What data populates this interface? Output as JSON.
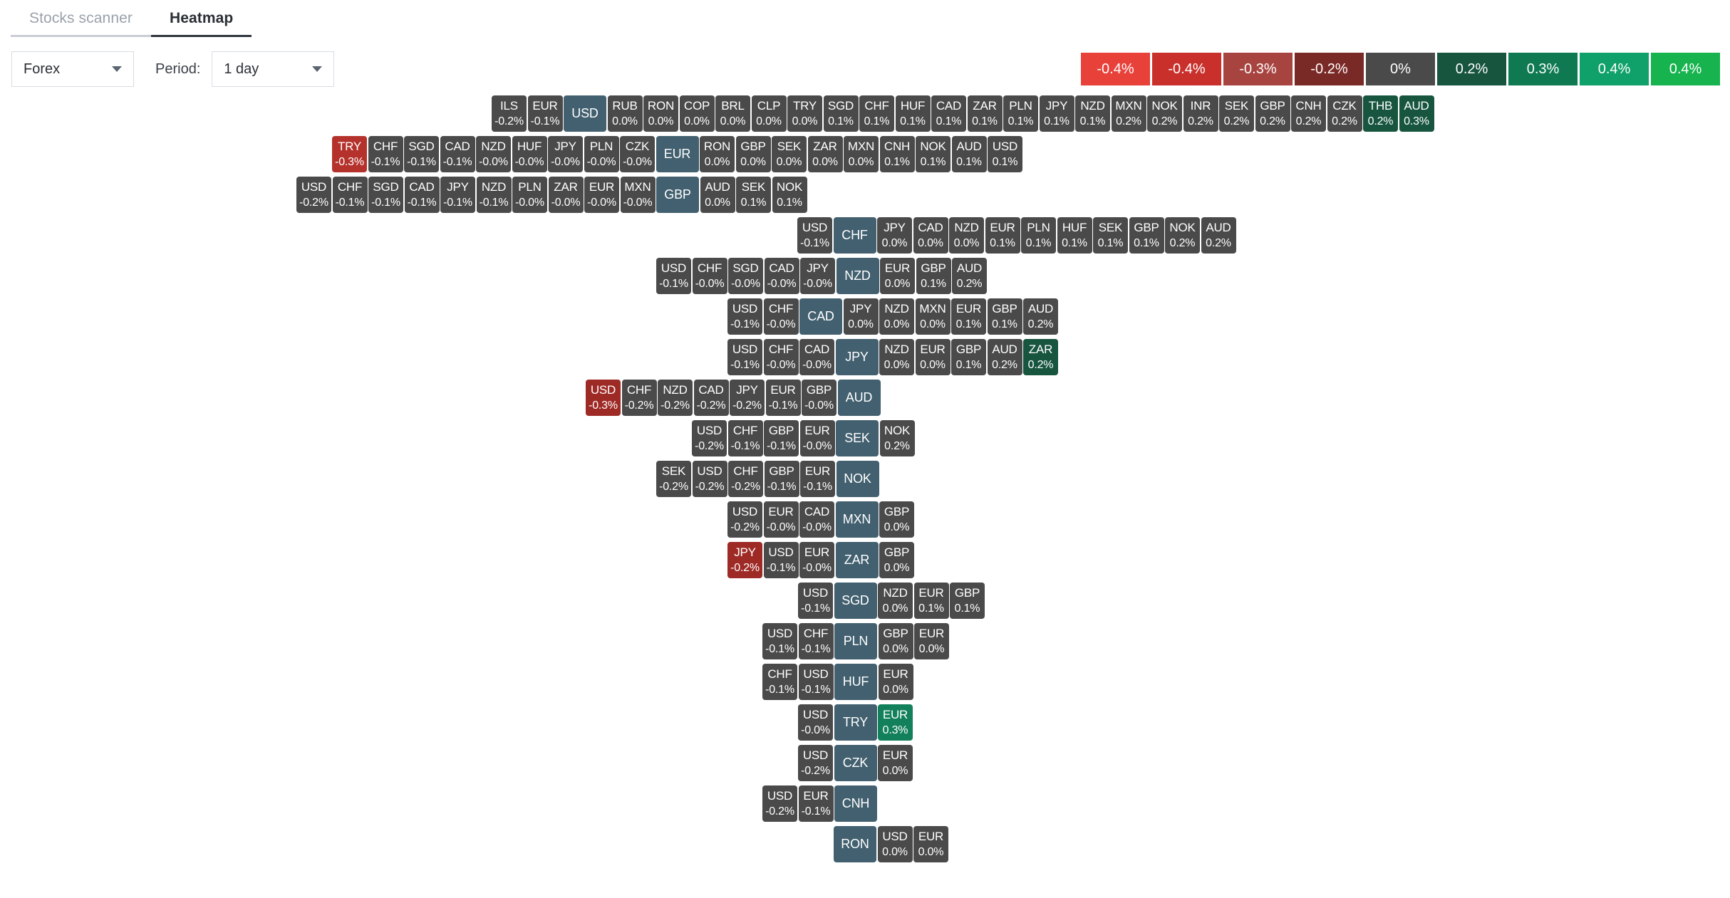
{
  "tabs": [
    {
      "label": "Stocks scanner",
      "active": false
    },
    {
      "label": "Heatmap",
      "active": true
    }
  ],
  "controls": {
    "market": "Forex",
    "period_label": "Period:",
    "period": "1 day",
    "market_caret_icon": "chevron-down-icon",
    "period_caret_icon": "chevron-down-icon"
  },
  "legend": [
    {
      "label": "-0.4%",
      "color": "#e8413a"
    },
    {
      "label": "-0.4%",
      "color": "#c9302c"
    },
    {
      "label": "-0.3%",
      "color": "#a84440"
    },
    {
      "label": "-0.2%",
      "color": "#7a2a26"
    },
    {
      "label": "0%",
      "color": "#4a4a4a"
    },
    {
      "label": "0.2%",
      "color": "#17553f"
    },
    {
      "label": "0.3%",
      "color": "#0f7a52"
    },
    {
      "label": "0.4%",
      "color": "#10a16a"
    },
    {
      "label": "0.4%",
      "color": "#16b34e"
    }
  ],
  "colors": {
    "neutral": "#4a4a4a",
    "base": "#42606f",
    "red_strong": "#9e2a26",
    "red_mid": "#b5322c",
    "green_dark": "#17553f",
    "green_mid": "#12805a"
  },
  "chart_data": {
    "type": "heatmap",
    "title": "Forex Heatmap",
    "period": "1 day",
    "value_unit": "percent",
    "rows": [
      {
        "base": "USD",
        "offset": 690,
        "cells": [
          {
            "sym": "ILS",
            "val": "-0.2%",
            "color": "#4a4a4a"
          },
          {
            "sym": "EUR",
            "val": "-0.1%",
            "color": "#4a4a4a"
          },
          {
            "sym": "USD",
            "val": "",
            "base": true
          },
          {
            "sym": "RUB",
            "val": "0.0%",
            "color": "#4a4a4a"
          },
          {
            "sym": "RON",
            "val": "0.0%",
            "color": "#4a4a4a"
          },
          {
            "sym": "COP",
            "val": "0.0%",
            "color": "#4a4a4a"
          },
          {
            "sym": "BRL",
            "val": "0.0%",
            "color": "#4a4a4a"
          },
          {
            "sym": "CLP",
            "val": "0.0%",
            "color": "#4a4a4a"
          },
          {
            "sym": "TRY",
            "val": "0.0%",
            "color": "#4a4a4a"
          },
          {
            "sym": "SGD",
            "val": "0.1%",
            "color": "#4a4a4a"
          },
          {
            "sym": "CHF",
            "val": "0.1%",
            "color": "#4a4a4a"
          },
          {
            "sym": "HUF",
            "val": "0.1%",
            "color": "#4a4a4a"
          },
          {
            "sym": "CAD",
            "val": "0.1%",
            "color": "#4a4a4a"
          },
          {
            "sym": "ZAR",
            "val": "0.1%",
            "color": "#4a4a4a"
          },
          {
            "sym": "PLN",
            "val": "0.1%",
            "color": "#4a4a4a"
          },
          {
            "sym": "JPY",
            "val": "0.1%",
            "color": "#4a4a4a"
          },
          {
            "sym": "NZD",
            "val": "0.1%",
            "color": "#4a4a4a"
          },
          {
            "sym": "MXN",
            "val": "0.2%",
            "color": "#4a4a4a"
          },
          {
            "sym": "NOK",
            "val": "0.2%",
            "color": "#4a4a4a"
          },
          {
            "sym": "INR",
            "val": "0.2%",
            "color": "#4a4a4a"
          },
          {
            "sym": "SEK",
            "val": "0.2%",
            "color": "#4a4a4a"
          },
          {
            "sym": "GBP",
            "val": "0.2%",
            "color": "#4a4a4a"
          },
          {
            "sym": "CNH",
            "val": "0.2%",
            "color": "#4a4a4a"
          },
          {
            "sym": "CZK",
            "val": "0.2%",
            "color": "#4a4a4a"
          },
          {
            "sym": "THB",
            "val": "0.2%",
            "color": "#17553f"
          },
          {
            "sym": "AUD",
            "val": "0.3%",
            "color": "#17553f"
          }
        ]
      },
      {
        "base": "EUR",
        "offset": 466,
        "cells": [
          {
            "sym": "TRY",
            "val": "-0.3%",
            "color": "#b5322c"
          },
          {
            "sym": "CHF",
            "val": "-0.1%",
            "color": "#4a4a4a"
          },
          {
            "sym": "SGD",
            "val": "-0.1%",
            "color": "#4a4a4a"
          },
          {
            "sym": "CAD",
            "val": "-0.1%",
            "color": "#4a4a4a"
          },
          {
            "sym": "NZD",
            "val": "-0.0%",
            "color": "#4a4a4a"
          },
          {
            "sym": "HUF",
            "val": "-0.0%",
            "color": "#4a4a4a"
          },
          {
            "sym": "JPY",
            "val": "-0.0%",
            "color": "#4a4a4a"
          },
          {
            "sym": "PLN",
            "val": "-0.0%",
            "color": "#4a4a4a"
          },
          {
            "sym": "CZK",
            "val": "-0.0%",
            "color": "#4a4a4a"
          },
          {
            "sym": "EUR",
            "val": "",
            "base": true
          },
          {
            "sym": "RON",
            "val": "0.0%",
            "color": "#4a4a4a"
          },
          {
            "sym": "GBP",
            "val": "0.0%",
            "color": "#4a4a4a"
          },
          {
            "sym": "SEK",
            "val": "0.0%",
            "color": "#4a4a4a"
          },
          {
            "sym": "ZAR",
            "val": "0.0%",
            "color": "#4a4a4a"
          },
          {
            "sym": "MXN",
            "val": "0.0%",
            "color": "#4a4a4a"
          },
          {
            "sym": "CNH",
            "val": "0.1%",
            "color": "#4a4a4a"
          },
          {
            "sym": "NOK",
            "val": "0.1%",
            "color": "#4a4a4a"
          },
          {
            "sym": "AUD",
            "val": "0.1%",
            "color": "#4a4a4a"
          },
          {
            "sym": "USD",
            "val": "0.1%",
            "color": "#4a4a4a"
          }
        ]
      },
      {
        "base": "GBP",
        "offset": 416,
        "cells": [
          {
            "sym": "USD",
            "val": "-0.2%",
            "color": "#4a4a4a"
          },
          {
            "sym": "CHF",
            "val": "-0.1%",
            "color": "#4a4a4a"
          },
          {
            "sym": "SGD",
            "val": "-0.1%",
            "color": "#4a4a4a"
          },
          {
            "sym": "CAD",
            "val": "-0.1%",
            "color": "#4a4a4a"
          },
          {
            "sym": "JPY",
            "val": "-0.1%",
            "color": "#4a4a4a"
          },
          {
            "sym": "NZD",
            "val": "-0.1%",
            "color": "#4a4a4a"
          },
          {
            "sym": "PLN",
            "val": "-0.0%",
            "color": "#4a4a4a"
          },
          {
            "sym": "ZAR",
            "val": "-0.0%",
            "color": "#4a4a4a"
          },
          {
            "sym": "EUR",
            "val": "-0.0%",
            "color": "#4a4a4a"
          },
          {
            "sym": "MXN",
            "val": "-0.0%",
            "color": "#4a4a4a"
          },
          {
            "sym": "GBP",
            "val": "",
            "base": true
          },
          {
            "sym": "AUD",
            "val": "0.0%",
            "color": "#4a4a4a"
          },
          {
            "sym": "SEK",
            "val": "0.1%",
            "color": "#4a4a4a"
          },
          {
            "sym": "NOK",
            "val": "0.1%",
            "color": "#4a4a4a"
          }
        ]
      },
      {
        "base": "CHF",
        "offset": 1119,
        "cells": [
          {
            "sym": "USD",
            "val": "-0.1%",
            "color": "#4a4a4a"
          },
          {
            "sym": "CHF",
            "val": "",
            "base": true
          },
          {
            "sym": "JPY",
            "val": "0.0%",
            "color": "#4a4a4a"
          },
          {
            "sym": "CAD",
            "val": "0.0%",
            "color": "#4a4a4a"
          },
          {
            "sym": "NZD",
            "val": "0.0%",
            "color": "#4a4a4a"
          },
          {
            "sym": "EUR",
            "val": "0.1%",
            "color": "#4a4a4a"
          },
          {
            "sym": "PLN",
            "val": "0.1%",
            "color": "#4a4a4a"
          },
          {
            "sym": "HUF",
            "val": "0.1%",
            "color": "#4a4a4a"
          },
          {
            "sym": "SEK",
            "val": "0.1%",
            "color": "#4a4a4a"
          },
          {
            "sym": "GBP",
            "val": "0.1%",
            "color": "#4a4a4a"
          },
          {
            "sym": "NOK",
            "val": "0.2%",
            "color": "#4a4a4a"
          },
          {
            "sym": "AUD",
            "val": "0.2%",
            "color": "#4a4a4a"
          }
        ]
      },
      {
        "base": "NZD",
        "offset": 921,
        "cells": [
          {
            "sym": "USD",
            "val": "-0.1%",
            "color": "#4a4a4a"
          },
          {
            "sym": "CHF",
            "val": "-0.0%",
            "color": "#4a4a4a"
          },
          {
            "sym": "SGD",
            "val": "-0.0%",
            "color": "#4a4a4a"
          },
          {
            "sym": "CAD",
            "val": "-0.0%",
            "color": "#4a4a4a"
          },
          {
            "sym": "JPY",
            "val": "-0.0%",
            "color": "#4a4a4a"
          },
          {
            "sym": "NZD",
            "val": "",
            "base": true
          },
          {
            "sym": "EUR",
            "val": "0.0%",
            "color": "#4a4a4a"
          },
          {
            "sym": "GBP",
            "val": "0.1%",
            "color": "#4a4a4a"
          },
          {
            "sym": "AUD",
            "val": "0.2%",
            "color": "#4a4a4a"
          }
        ]
      },
      {
        "base": "CAD",
        "offset": 1021,
        "cells": [
          {
            "sym": "USD",
            "val": "-0.1%",
            "color": "#4a4a4a"
          },
          {
            "sym": "CHF",
            "val": "-0.0%",
            "color": "#4a4a4a"
          },
          {
            "sym": "CAD",
            "val": "",
            "base": true
          },
          {
            "sym": "JPY",
            "val": "0.0%",
            "color": "#4a4a4a"
          },
          {
            "sym": "NZD",
            "val": "0.0%",
            "color": "#4a4a4a"
          },
          {
            "sym": "MXN",
            "val": "0.0%",
            "color": "#4a4a4a"
          },
          {
            "sym": "EUR",
            "val": "0.1%",
            "color": "#4a4a4a"
          },
          {
            "sym": "GBP",
            "val": "0.1%",
            "color": "#4a4a4a"
          },
          {
            "sym": "AUD",
            "val": "0.2%",
            "color": "#4a4a4a"
          }
        ]
      },
      {
        "base": "JPY",
        "offset": 1021,
        "cells": [
          {
            "sym": "USD",
            "val": "-0.1%",
            "color": "#4a4a4a"
          },
          {
            "sym": "CHF",
            "val": "-0.0%",
            "color": "#4a4a4a"
          },
          {
            "sym": "CAD",
            "val": "-0.0%",
            "color": "#4a4a4a"
          },
          {
            "sym": "JPY",
            "val": "",
            "base": true
          },
          {
            "sym": "NZD",
            "val": "0.0%",
            "color": "#4a4a4a"
          },
          {
            "sym": "EUR",
            "val": "0.0%",
            "color": "#4a4a4a"
          },
          {
            "sym": "GBP",
            "val": "0.1%",
            "color": "#4a4a4a"
          },
          {
            "sym": "AUD",
            "val": "0.2%",
            "color": "#4a4a4a"
          },
          {
            "sym": "ZAR",
            "val": "0.2%",
            "color": "#17553f"
          }
        ]
      },
      {
        "base": "AUD",
        "offset": 822,
        "cells": [
          {
            "sym": "USD",
            "val": "-0.3%",
            "color": "#9e2a26"
          },
          {
            "sym": "CHF",
            "val": "-0.2%",
            "color": "#4a4a4a"
          },
          {
            "sym": "NZD",
            "val": "-0.2%",
            "color": "#4a4a4a"
          },
          {
            "sym": "CAD",
            "val": "-0.2%",
            "color": "#4a4a4a"
          },
          {
            "sym": "JPY",
            "val": "-0.2%",
            "color": "#4a4a4a"
          },
          {
            "sym": "EUR",
            "val": "-0.1%",
            "color": "#4a4a4a"
          },
          {
            "sym": "GBP",
            "val": "-0.0%",
            "color": "#4a4a4a"
          },
          {
            "sym": "AUD",
            "val": "",
            "base": true
          }
        ]
      },
      {
        "base": "SEK",
        "offset": 971,
        "cells": [
          {
            "sym": "USD",
            "val": "-0.2%",
            "color": "#4a4a4a"
          },
          {
            "sym": "CHF",
            "val": "-0.1%",
            "color": "#4a4a4a"
          },
          {
            "sym": "GBP",
            "val": "-0.1%",
            "color": "#4a4a4a"
          },
          {
            "sym": "EUR",
            "val": "-0.0%",
            "color": "#4a4a4a"
          },
          {
            "sym": "SEK",
            "val": "",
            "base": true
          },
          {
            "sym": "NOK",
            "val": "0.2%",
            "color": "#4a4a4a"
          }
        ]
      },
      {
        "base": "NOK",
        "offset": 921,
        "cells": [
          {
            "sym": "SEK",
            "val": "-0.2%",
            "color": "#4a4a4a"
          },
          {
            "sym": "USD",
            "val": "-0.2%",
            "color": "#4a4a4a"
          },
          {
            "sym": "CHF",
            "val": "-0.2%",
            "color": "#4a4a4a"
          },
          {
            "sym": "GBP",
            "val": "-0.1%",
            "color": "#4a4a4a"
          },
          {
            "sym": "EUR",
            "val": "-0.1%",
            "color": "#4a4a4a"
          },
          {
            "sym": "NOK",
            "val": "",
            "base": true
          }
        ]
      },
      {
        "base": "MXN",
        "offset": 1021,
        "cells": [
          {
            "sym": "USD",
            "val": "-0.2%",
            "color": "#4a4a4a"
          },
          {
            "sym": "EUR",
            "val": "-0.0%",
            "color": "#4a4a4a"
          },
          {
            "sym": "CAD",
            "val": "-0.0%",
            "color": "#4a4a4a"
          },
          {
            "sym": "MXN",
            "val": "",
            "base": true
          },
          {
            "sym": "GBP",
            "val": "0.0%",
            "color": "#4a4a4a"
          }
        ]
      },
      {
        "base": "ZAR",
        "offset": 1021,
        "cells": [
          {
            "sym": "JPY",
            "val": "-0.2%",
            "color": "#9e2a26"
          },
          {
            "sym": "USD",
            "val": "-0.1%",
            "color": "#4a4a4a"
          },
          {
            "sym": "EUR",
            "val": "-0.0%",
            "color": "#4a4a4a"
          },
          {
            "sym": "ZAR",
            "val": "",
            "base": true
          },
          {
            "sym": "GBP",
            "val": "0.0%",
            "color": "#4a4a4a"
          }
        ]
      },
      {
        "base": "SGD",
        "offset": 1120,
        "cells": [
          {
            "sym": "USD",
            "val": "-0.1%",
            "color": "#4a4a4a"
          },
          {
            "sym": "SGD",
            "val": "",
            "base": true
          },
          {
            "sym": "NZD",
            "val": "0.0%",
            "color": "#4a4a4a"
          },
          {
            "sym": "EUR",
            "val": "0.1%",
            "color": "#4a4a4a"
          },
          {
            "sym": "GBP",
            "val": "0.1%",
            "color": "#4a4a4a"
          }
        ]
      },
      {
        "base": "PLN",
        "offset": 1070,
        "cells": [
          {
            "sym": "USD",
            "val": "-0.1%",
            "color": "#4a4a4a"
          },
          {
            "sym": "CHF",
            "val": "-0.1%",
            "color": "#4a4a4a"
          },
          {
            "sym": "PLN",
            "val": "",
            "base": true
          },
          {
            "sym": "GBP",
            "val": "0.0%",
            "color": "#4a4a4a"
          },
          {
            "sym": "EUR",
            "val": "0.0%",
            "color": "#4a4a4a"
          }
        ]
      },
      {
        "base": "HUF",
        "offset": 1070,
        "cells": [
          {
            "sym": "CHF",
            "val": "-0.1%",
            "color": "#4a4a4a"
          },
          {
            "sym": "USD",
            "val": "-0.1%",
            "color": "#4a4a4a"
          },
          {
            "sym": "HUF",
            "val": "",
            "base": true
          },
          {
            "sym": "EUR",
            "val": "0.0%",
            "color": "#4a4a4a"
          }
        ]
      },
      {
        "base": "TRY",
        "offset": 1120,
        "cells": [
          {
            "sym": "USD",
            "val": "-0.0%",
            "color": "#4a4a4a"
          },
          {
            "sym": "TRY",
            "val": "",
            "base": true
          },
          {
            "sym": "EUR",
            "val": "0.3%",
            "color": "#12805a"
          }
        ]
      },
      {
        "base": "CZK",
        "offset": 1120,
        "cells": [
          {
            "sym": "USD",
            "val": "-0.2%",
            "color": "#4a4a4a"
          },
          {
            "sym": "CZK",
            "val": "",
            "base": true
          },
          {
            "sym": "EUR",
            "val": "0.0%",
            "color": "#4a4a4a"
          }
        ]
      },
      {
        "base": "CNH",
        "offset": 1070,
        "cells": [
          {
            "sym": "USD",
            "val": "-0.2%",
            "color": "#4a4a4a"
          },
          {
            "sym": "EUR",
            "val": "-0.1%",
            "color": "#4a4a4a"
          },
          {
            "sym": "CNH",
            "val": "",
            "base": true
          }
        ]
      },
      {
        "base": "RON",
        "offset": 1170,
        "cells": [
          {
            "sym": "RON",
            "val": "",
            "base": true
          },
          {
            "sym": "USD",
            "val": "0.0%",
            "color": "#4a4a4a"
          },
          {
            "sym": "EUR",
            "val": "0.0%",
            "color": "#4a4a4a"
          }
        ]
      }
    ]
  }
}
